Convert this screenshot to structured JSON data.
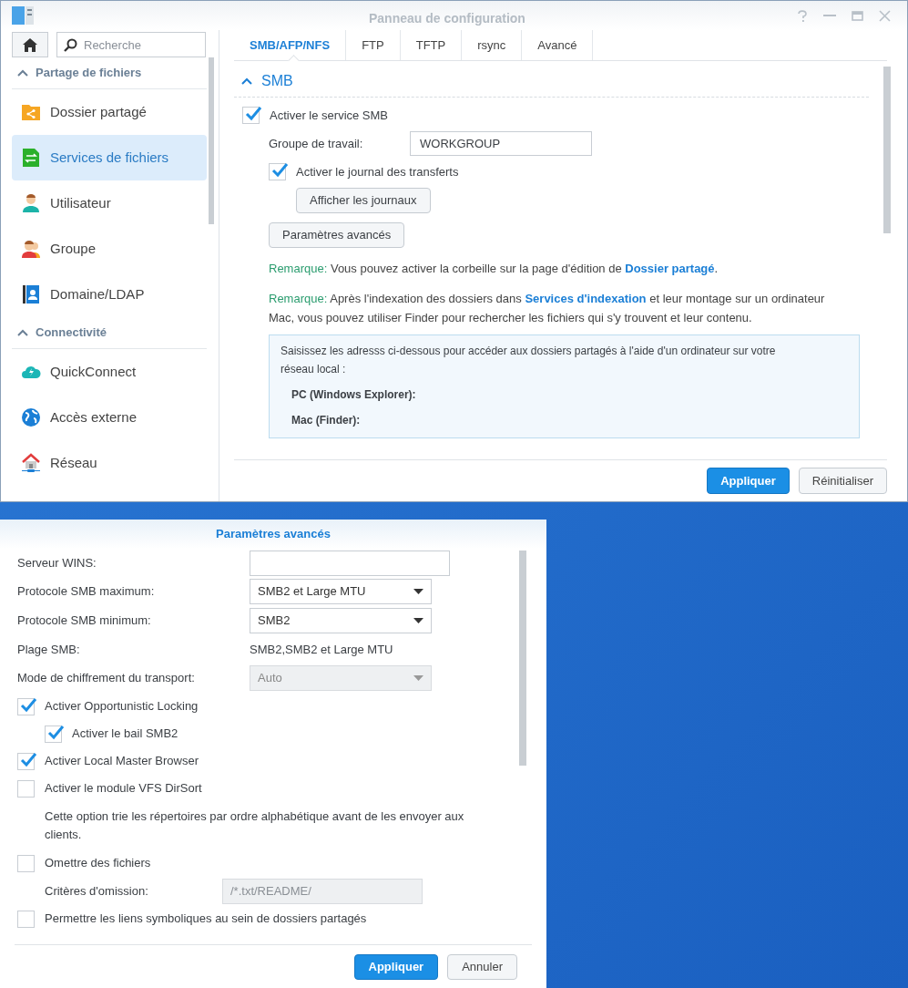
{
  "window": {
    "title": "Panneau de configuration"
  },
  "sidebar": {
    "search": {
      "placeholder": "Recherche"
    },
    "sections": [
      {
        "title": "Partage de fichiers",
        "expanded": true,
        "items": [
          {
            "label": "Dossier partagé",
            "kind": "folder",
            "selected": false
          },
          {
            "label": "Services de fichiers",
            "kind": "transfer",
            "selected": true
          },
          {
            "label": "Utilisateur",
            "kind": "user",
            "selected": false
          },
          {
            "label": "Groupe",
            "kind": "group",
            "selected": false
          },
          {
            "label": "Domaine/LDAP",
            "kind": "directory",
            "selected": false
          }
        ]
      },
      {
        "title": "Connectivité",
        "expanded": true,
        "items": [
          {
            "label": "QuickConnect",
            "kind": "cloud",
            "selected": false
          },
          {
            "label": "Accès externe",
            "kind": "globe",
            "selected": false
          },
          {
            "label": "Réseau",
            "kind": "house",
            "selected": false
          }
        ]
      }
    ]
  },
  "tabs": [
    {
      "label": "SMB/AFP/NFS",
      "selected": true
    },
    {
      "label": "FTP",
      "selected": false
    },
    {
      "label": "TFTP",
      "selected": false
    },
    {
      "label": "rsync",
      "selected": false
    },
    {
      "label": "Avancé",
      "selected": false
    }
  ],
  "smb": {
    "title": "SMB",
    "expanded": true,
    "enable": {
      "label": "Activer le service SMB",
      "checked": true
    },
    "workgroup": {
      "label": "Groupe de travail:",
      "value": "WORKGROUP"
    },
    "log": {
      "label": "Activer le journal des transferts",
      "checked": true
    },
    "log_button": "Afficher les journaux",
    "advanced_button": "Paramètres avancés",
    "notes": [
      {
        "label": "Remarque:",
        "before": " Vous pouvez activer la corbeille sur la page d'édition de ",
        "link": "Dossier partagé",
        "after": "."
      },
      {
        "label": "Remarque:",
        "before": " Après l'indexation des dossiers dans ",
        "link": "Services d'indexation",
        "after": " et leur montage sur un ordinateur Mac, vous pouvez utiliser Finder pour rechercher les fichiers qui s'y trouvent et leur contenu."
      }
    ],
    "info": {
      "text": "Saisissez les adresss ci-dessous pour accéder aux dossiers partagés à l'aide d'un ordinateur sur votre réseau local :",
      "rows": [
        {
          "label": "PC (Windows Explorer):"
        },
        {
          "label": "Mac (Finder):"
        }
      ]
    }
  },
  "footer_buttons": [
    {
      "label": "Appliquer",
      "kind": "primary"
    },
    {
      "label": "Réinitialiser",
      "kind": "secondary"
    }
  ],
  "dialog": {
    "title": "Paramètres avancés",
    "rows": [
      {
        "kind": "text-field",
        "label": "Serveur WINS:",
        "disabled": false
      },
      {
        "kind": "select",
        "label": "Protocole SMB maximum:",
        "value": "SMB2 et Large MTU",
        "disabled": false
      },
      {
        "kind": "select",
        "label": "Protocole SMB minimum:",
        "value": "SMB2",
        "disabled": false
      },
      {
        "kind": "static",
        "label": "Plage SMB:",
        "value": "SMB2,SMB2 et Large MTU"
      },
      {
        "kind": "select",
        "label": "Mode de chiffrement du transport:",
        "value": "Auto",
        "disabled": true
      },
      {
        "kind": "checkbox",
        "label": "Activer Opportunistic Locking",
        "checked": true,
        "children": [
          {
            "kind": "checkbox",
            "label": "Activer le bail SMB2",
            "checked": true
          }
        ]
      },
      {
        "kind": "checkbox",
        "label": "Activer Local Master Browser",
        "checked": true
      },
      {
        "kind": "checkbox",
        "label": "Activer le module VFS DirSort",
        "checked": false,
        "children": [
          {
            "kind": "note",
            "text": "Cette option trie les répertoires par ordre alphabétique avant de les envoyer aux clients."
          }
        ]
      },
      {
        "kind": "checkbox",
        "label": "Omettre des fichiers",
        "checked": false,
        "children": [
          {
            "kind": "text-field",
            "label": "Critères d'omission:",
            "placeholder": "/*.txt/README/",
            "disabled": true
          }
        ]
      },
      {
        "kind": "checkbox",
        "label": "Permettre les liens symboliques au sein de dossiers partagés",
        "checked": false
      }
    ],
    "buttons": [
      {
        "label": "Appliquer",
        "kind": "primary"
      },
      {
        "label": "Annuler",
        "kind": "secondary"
      }
    ]
  }
}
